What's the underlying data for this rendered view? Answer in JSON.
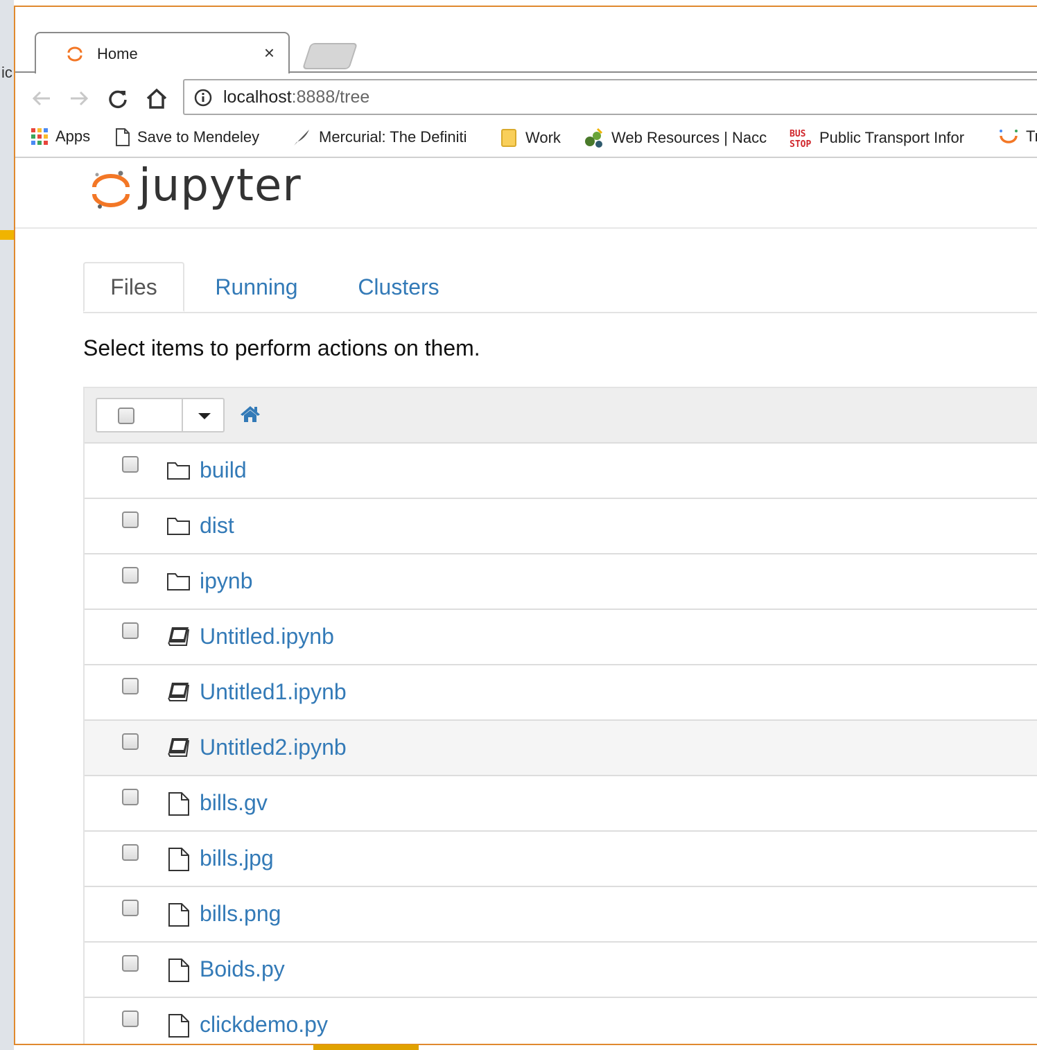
{
  "browser": {
    "tab": {
      "title": "Home",
      "close_glyph": "×"
    },
    "address": {
      "host": "localhost",
      "rest": ":8888/tree"
    },
    "bookmarks": [
      {
        "label": "Apps",
        "icon": "apps-grid-icon"
      },
      {
        "label": "Save to Mendeley",
        "icon": "page-icon"
      },
      {
        "label": "Mercurial: The Definiti",
        "icon": "feather-icon"
      },
      {
        "label": "Work",
        "icon": "folder-icon"
      },
      {
        "label": "Web Resources | Nacc",
        "icon": "web-resources-icon"
      },
      {
        "label": "Public Transport Infor",
        "icon": "bus-stop-icon"
      },
      {
        "label": "Tr",
        "icon": "jupyter-small-icon"
      }
    ]
  },
  "jupyter": {
    "logo_text": "jupyter",
    "tabs": [
      {
        "label": "Files",
        "active": true
      },
      {
        "label": "Running",
        "active": false
      },
      {
        "label": "Clusters",
        "active": false
      }
    ],
    "hint": "Select items to perform actions on them.",
    "items": [
      {
        "name": "build",
        "kind": "folder"
      },
      {
        "name": "dist",
        "kind": "folder"
      },
      {
        "name": "ipynb",
        "kind": "folder"
      },
      {
        "name": "Untitled.ipynb",
        "kind": "notebook"
      },
      {
        "name": "Untitled1.ipynb",
        "kind": "notebook"
      },
      {
        "name": "Untitled2.ipynb",
        "kind": "notebook"
      },
      {
        "name": "bills.gv",
        "kind": "file"
      },
      {
        "name": "bills.jpg",
        "kind": "file"
      },
      {
        "name": "bills.png",
        "kind": "file"
      },
      {
        "name": "Boids.py",
        "kind": "file"
      },
      {
        "name": "clickdemo.py",
        "kind": "file"
      }
    ]
  },
  "colors": {
    "link": "#337ab7",
    "jupyter_orange": "#f37726",
    "window_border": "#e0892e"
  }
}
